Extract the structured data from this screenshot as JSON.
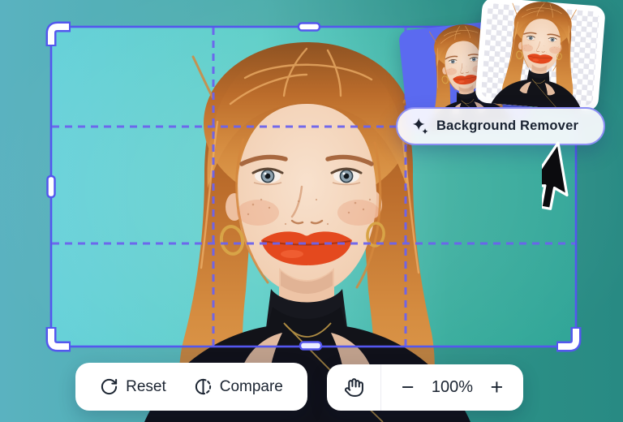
{
  "editor": {
    "tool_label": "Background Remover",
    "reset_label": "Reset",
    "compare_label": "Compare",
    "zoom_percent": "100%",
    "zoom_out_symbol": "−",
    "zoom_in_symbol": "+"
  },
  "icons": {
    "sparkles": "sparkles-icon",
    "reset": "reset-rotate-icon",
    "compare": "compare-contrast-icon",
    "hand": "hand-pan-icon",
    "minus": "zoom-out-minus-icon",
    "plus": "zoom-in-plus-icon",
    "cursor": "cursor-arrow-icon"
  },
  "colors": {
    "accent_purple": "#5457ee",
    "grid_purple": "#6c63ee",
    "pill_border": "#8d8ff4",
    "card_blue": "#5b6af0",
    "backdrop_teal_left": "#68d0dd",
    "backdrop_teal_right": "#2fa396",
    "hair_copper": "#cd7d36",
    "lips_orange": "#e4491e",
    "text_dark": "#1c2532"
  }
}
